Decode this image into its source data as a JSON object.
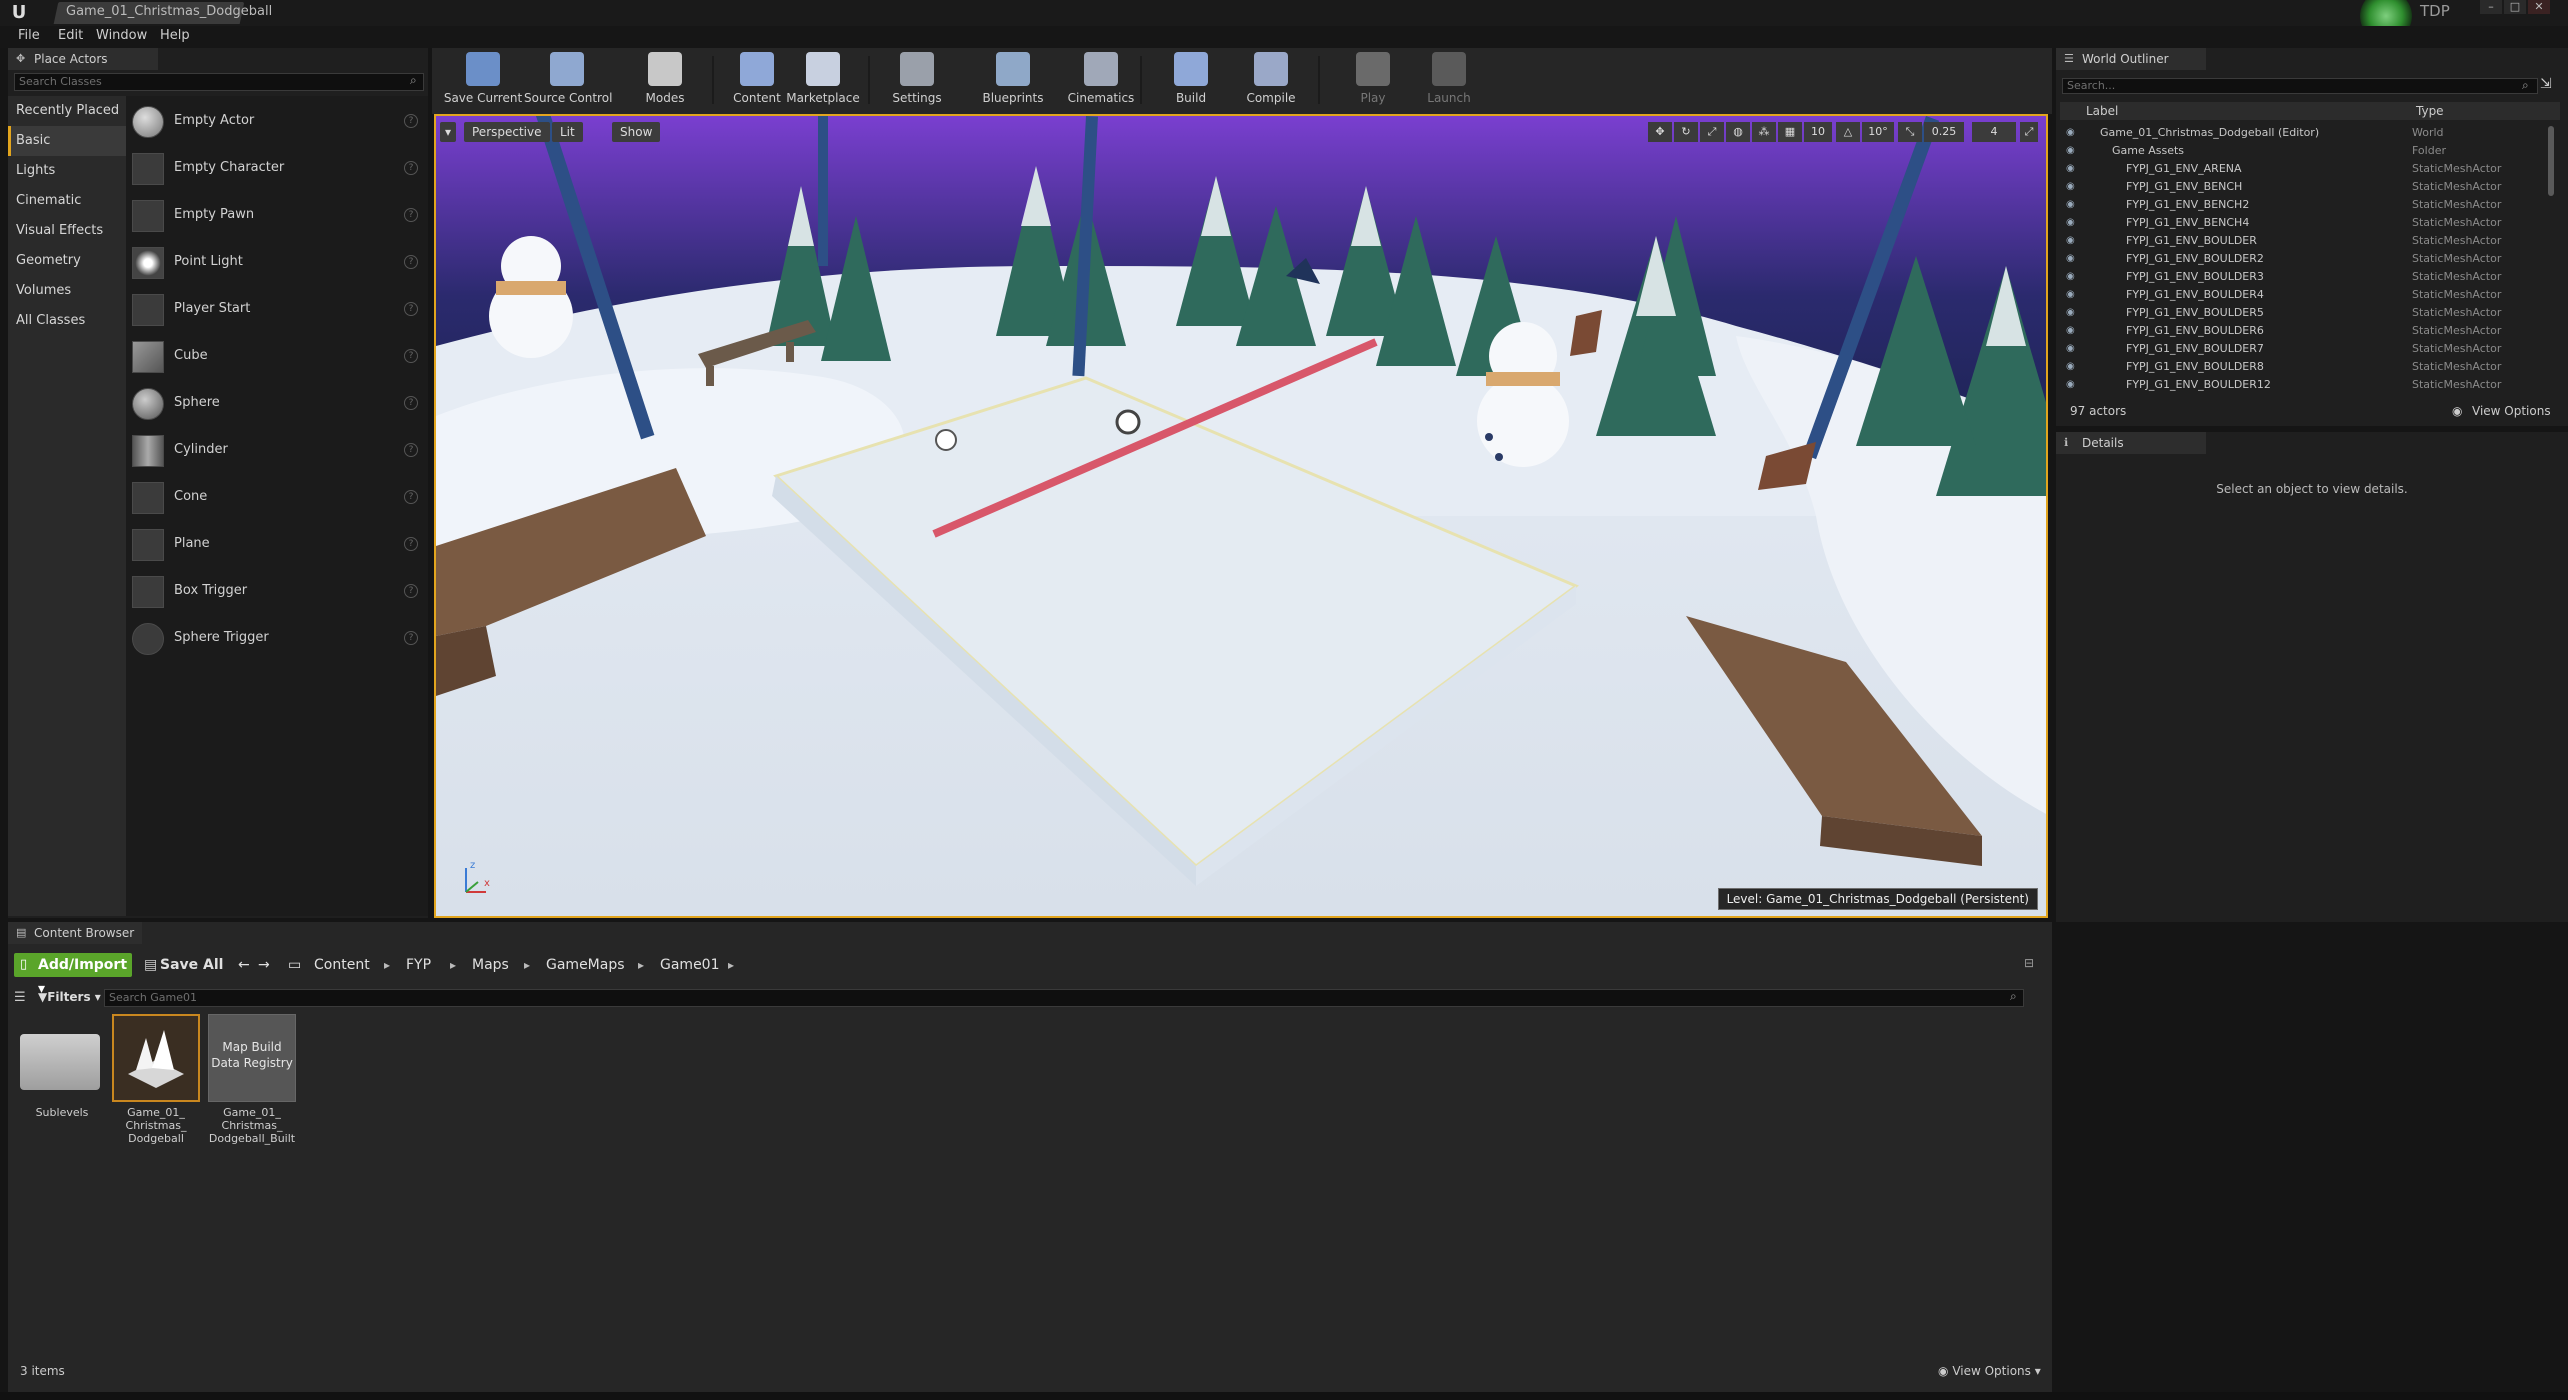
{
  "window": {
    "doc_tab": "Game_01_Christmas_Dodgeball",
    "user_badge": "TDP",
    "min_icon": "minimize-icon",
    "max_icon": "maximize-icon",
    "close_icon": "close-icon"
  },
  "menu": [
    "File",
    "Edit",
    "Window",
    "Help"
  ],
  "place_actors": {
    "tab_label": "Place Actors",
    "search_placeholder": "Search Classes",
    "categories": [
      "Recently Placed",
      "Basic",
      "Lights",
      "Cinematic",
      "Visual Effects",
      "Geometry",
      "Volumes",
      "All Classes"
    ],
    "active_category": "Basic",
    "actors": [
      "Empty Actor",
      "Empty Character",
      "Empty Pawn",
      "Point Light",
      "Player Start",
      "Cube",
      "Sphere",
      "Cylinder",
      "Cone",
      "Plane",
      "Box Trigger",
      "Sphere Trigger"
    ],
    "help_glyph": "?"
  },
  "toolbar": {
    "buttons": [
      "Save Current",
      "Source Control",
      "Modes",
      "Content",
      "Marketplace",
      "Settings",
      "Blueprints",
      "Cinematics",
      "Build",
      "Compile",
      "Play",
      "Launch"
    ],
    "icons": [
      "save-icon",
      "source-control-icon",
      "modes-icon",
      "content-icon",
      "marketplace-icon",
      "settings-icon",
      "blueprints-icon",
      "cinematics-icon",
      "build-icon",
      "compile-icon",
      "play-icon",
      "launch-icon"
    ]
  },
  "viewport": {
    "perspective_label": "Perspective",
    "lit_label": "Lit",
    "show_label": "Show",
    "grid_snap": "10",
    "rotation_snap": "10°",
    "scale_snap": "0.25",
    "camera_speed": "4",
    "level_label": "Level:  Game_01_Christmas_Dodgeball (Persistent)",
    "axis_x": "x",
    "axis_z": "z"
  },
  "outliner": {
    "tab_label": "World Outliner",
    "search_placeholder": "Search...",
    "col_label": "Label",
    "col_type": "Type",
    "rows": [
      {
        "label": "Game_01_Christmas_Dodgeball (Editor)",
        "type": "World"
      },
      {
        "label": "Game Assets",
        "type": "Folder"
      },
      {
        "label": "FYPJ_G1_ENV_ARENA",
        "type": "StaticMeshActor"
      },
      {
        "label": "FYPJ_G1_ENV_BENCH",
        "type": "StaticMeshActor"
      },
      {
        "label": "FYPJ_G1_ENV_BENCH2",
        "type": "StaticMeshActor"
      },
      {
        "label": "FYPJ_G1_ENV_BENCH4",
        "type": "StaticMeshActor"
      },
      {
        "label": "FYPJ_G1_ENV_BOULDER",
        "type": "StaticMeshActor"
      },
      {
        "label": "FYPJ_G1_ENV_BOULDER2",
        "type": "StaticMeshActor"
      },
      {
        "label": "FYPJ_G1_ENV_BOULDER3",
        "type": "StaticMeshActor"
      },
      {
        "label": "FYPJ_G1_ENV_BOULDER4",
        "type": "StaticMeshActor"
      },
      {
        "label": "FYPJ_G1_ENV_BOULDER5",
        "type": "StaticMeshActor"
      },
      {
        "label": "FYPJ_G1_ENV_BOULDER6",
        "type": "StaticMeshActor"
      },
      {
        "label": "FYPJ_G1_ENV_BOULDER7",
        "type": "StaticMeshActor"
      },
      {
        "label": "FYPJ_G1_ENV_BOULDER8",
        "type": "StaticMeshActor"
      },
      {
        "label": "FYPJ_G1_ENV_BOULDER12",
        "type": "StaticMeshActor"
      }
    ],
    "actor_count": "97 actors",
    "view_options": "View Options"
  },
  "details": {
    "tab_label": "Details",
    "empty_message": "Select an object to view details."
  },
  "content_browser": {
    "tab_label": "Content Browser",
    "add_import": "Add/Import",
    "save_all": "Save All",
    "path": [
      "Content",
      "FYP",
      "Maps",
      "GameMaps",
      "Game01"
    ],
    "filters_label": "Filters",
    "search_placeholder": "Search Game01",
    "assets": [
      {
        "label": "Sublevels"
      },
      {
        "label": "Game_01_ Christmas_ Dodgeball"
      },
      {
        "label": "Game_01_ Christmas_ Dodgeball_Built",
        "thumb_text": "Map Build Data Registry"
      }
    ],
    "item_count": "3 items",
    "view_options": "View Options"
  },
  "colors": {
    "accent_selection": "#e2a51e",
    "add_import_green": "#5aa52a",
    "court_red_line": "#d8576a",
    "sky_purple": "#7a3fd0"
  }
}
